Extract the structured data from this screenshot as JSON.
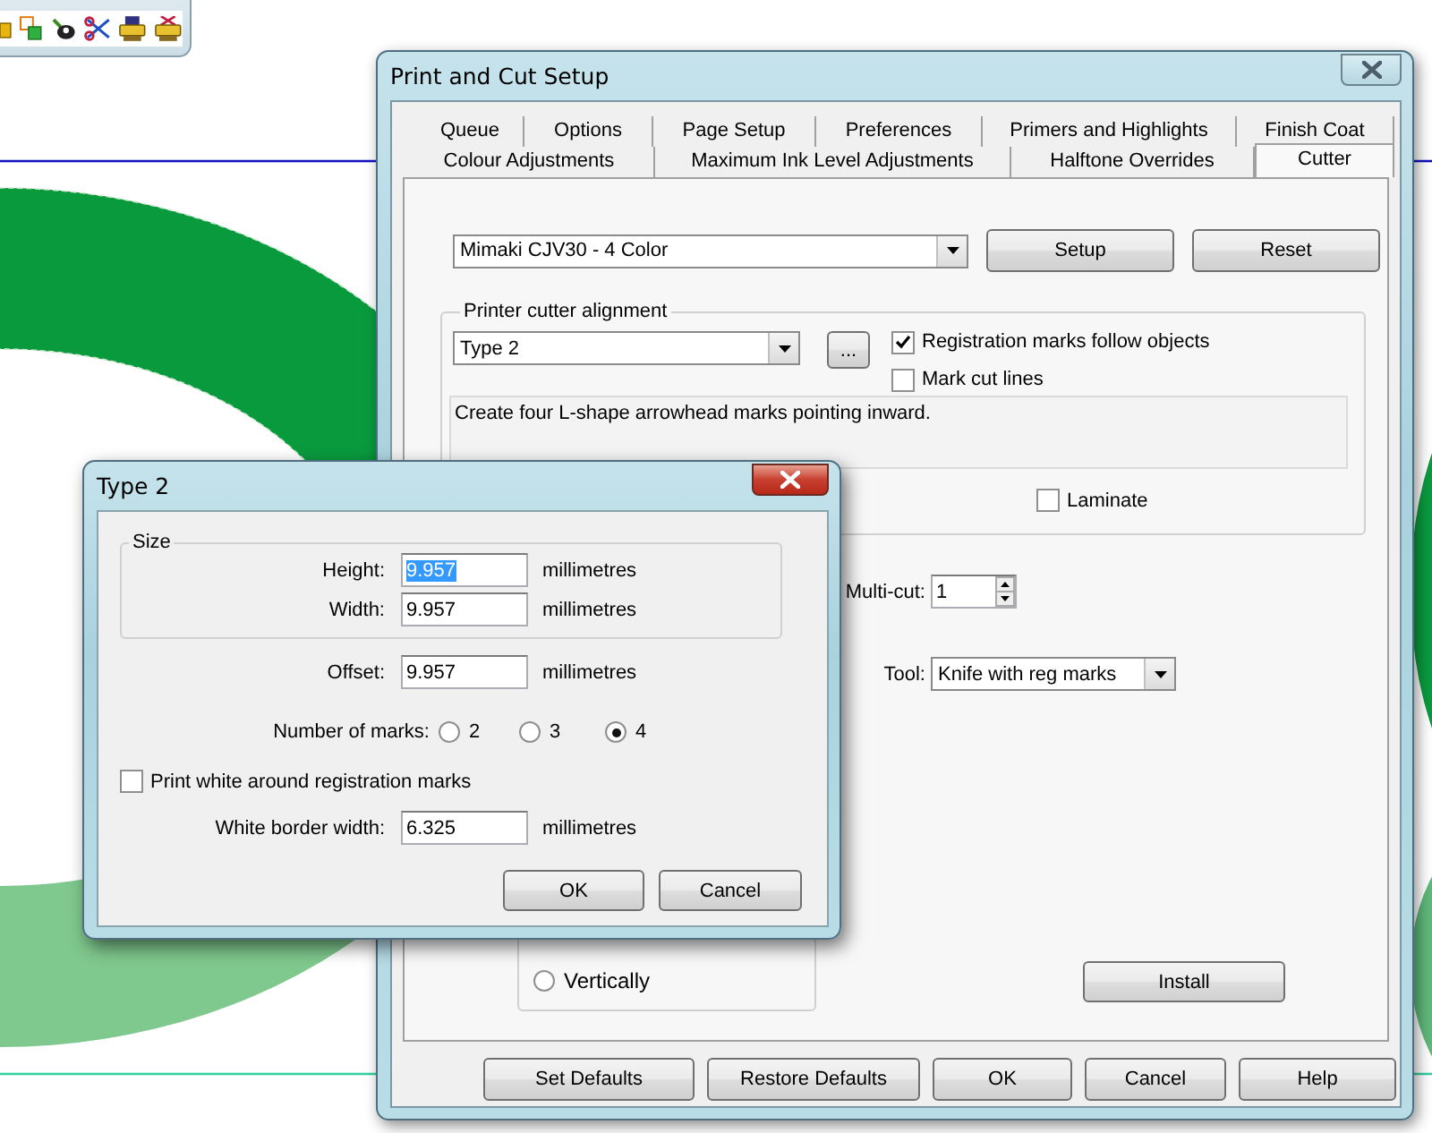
{
  "main_dialog": {
    "title": "Print and Cut Setup",
    "tab_rows": [
      [
        {
          "label": "Queue",
          "selected": false
        },
        {
          "label": "Options",
          "selected": false
        },
        {
          "label": "Page Setup",
          "selected": false
        },
        {
          "label": "Preferences",
          "selected": false
        },
        {
          "label": "Primers and Highlights",
          "selected": false
        },
        {
          "label": "Finish Coat",
          "selected": false
        }
      ],
      [
        {
          "label": "Colour Adjustments",
          "selected": false
        },
        {
          "label": "Maximum Ink Level Adjustments",
          "selected": false
        },
        {
          "label": "Halftone Overrides",
          "selected": false
        },
        {
          "label": "Cutter",
          "selected": true
        }
      ]
    ],
    "printer": {
      "value": "Mimaki CJV30 - 4 Color"
    },
    "printer_buttons": [
      "Setup",
      "Reset"
    ],
    "alignment": {
      "legend": "Printer cutter alignment",
      "type_value": "Type 2",
      "browse_button": "...",
      "checkboxes": [
        {
          "label": "Registration marks follow objects",
          "checked": true
        },
        {
          "label": "Mark cut lines",
          "checked": false
        }
      ],
      "description": "Create four L-shape arrowhead marks pointing inward.",
      "laminate": {
        "label": "Laminate",
        "checked": false
      }
    },
    "multi_cut": {
      "label": "Multi-cut:",
      "value": "1"
    },
    "tool": {
      "label": "Tool:",
      "value": "Knife with reg marks"
    },
    "direction": {
      "label": "Vertically",
      "selected": false
    },
    "install_button": "Install",
    "footer_buttons": [
      "Set Defaults",
      "Restore Defaults",
      "OK",
      "Cancel",
      "Help"
    ]
  },
  "type_dialog": {
    "title": "Type 2",
    "size_legend": "Size",
    "size_fields": [
      {
        "label": "Height:",
        "value": "9.957",
        "unit": "millimetres",
        "text_selected": true
      },
      {
        "label": "Width:",
        "value": "9.957",
        "unit": "millimetres",
        "text_selected": false
      }
    ],
    "offset": {
      "label": "Offset:",
      "value": "9.957",
      "unit": "millimetres"
    },
    "marks": {
      "label": "Number of marks:",
      "options": [
        {
          "label": "2",
          "selected": false
        },
        {
          "label": "3",
          "selected": false
        },
        {
          "label": "4",
          "selected": true
        }
      ]
    },
    "print_white": {
      "label": "Print white around registration marks",
      "checked": false
    },
    "border_width": {
      "label": "White border width:",
      "value": "6.325",
      "unit": "millimetres"
    },
    "buttons": [
      "OK",
      "Cancel"
    ]
  }
}
